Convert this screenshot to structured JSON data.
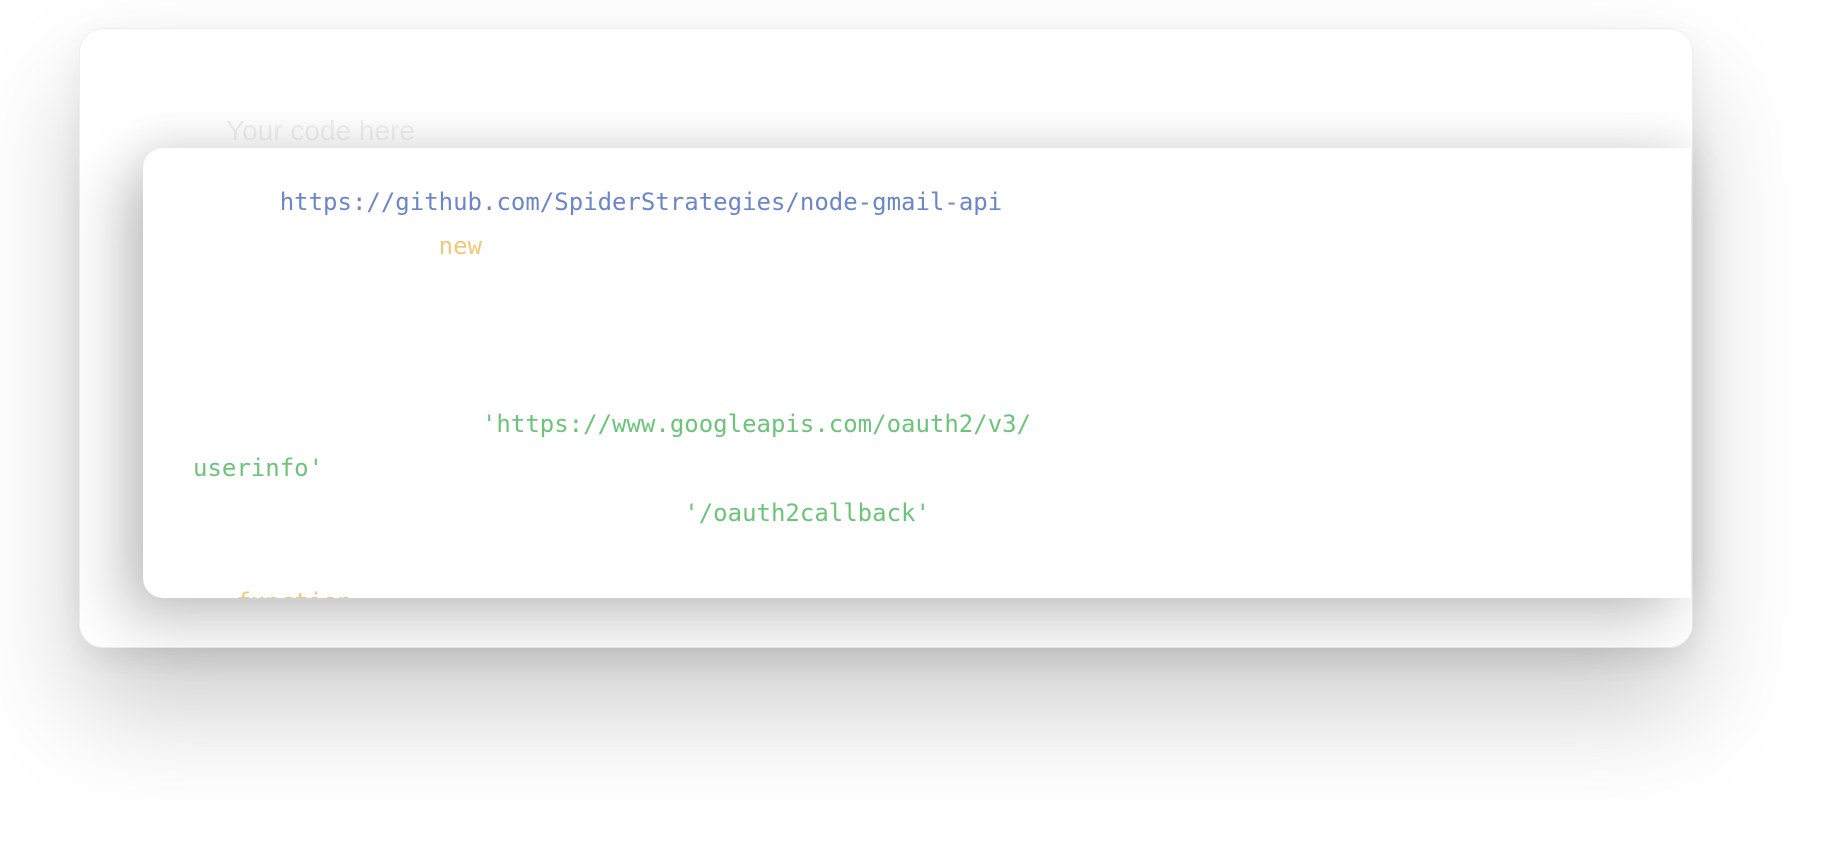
{
  "editor": {
    "placeholder": "Your code here",
    "colors": {
      "link": "#6c86c9",
      "keyword": "#f4c777",
      "string": "#6cc47a"
    },
    "tokens": {
      "repo_url": "https://github.com/SpiderStrategies/node-gmail-api",
      "new_kw": "new",
      "userinfo_url_part1": "'https://www.googleapis.com/oauth2/v3/",
      "userinfo_url_part2": "userinfo'",
      "callback_path": "'/oauth2callback'",
      "function_kw": "function"
    }
  }
}
